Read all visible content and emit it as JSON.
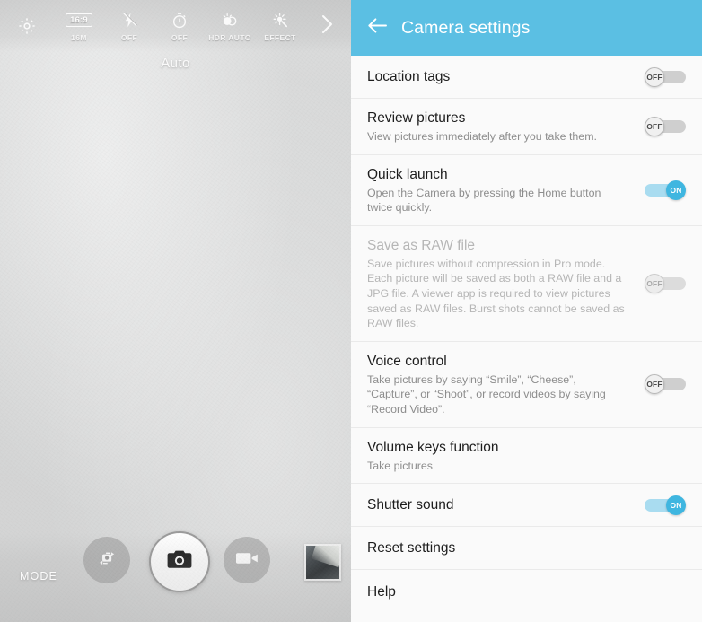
{
  "camera": {
    "mode_label": "Auto",
    "mode_button_label": "MODE",
    "toolbar": [
      {
        "icon": "settings-gear-icon",
        "label": "",
        "name": "camera-settings-gear"
      },
      {
        "icon": "aspect-ratio-icon",
        "ratio": "16:9",
        "label": "16M",
        "name": "camera-aspect-ratio"
      },
      {
        "icon": "flash-off-icon",
        "label": "OFF",
        "name": "camera-flash"
      },
      {
        "icon": "timer-icon",
        "label": "OFF",
        "name": "camera-timer"
      },
      {
        "icon": "hdr-icon",
        "label": "HDR AUTO",
        "name": "camera-hdr"
      },
      {
        "icon": "effect-icon",
        "label": "EFFECT",
        "name": "camera-effect"
      },
      {
        "icon": "chevron-right-icon",
        "label": "",
        "name": "camera-more"
      }
    ],
    "controls": [
      {
        "name": "switch-camera-button",
        "icon": "switch-camera-icon"
      },
      {
        "name": "shutter-button",
        "icon": "camera-icon"
      },
      {
        "name": "record-video-button",
        "icon": "video-camera-icon"
      },
      {
        "name": "gallery-thumbnail",
        "icon": "photo-thumbnail"
      }
    ]
  },
  "settings": {
    "title": "Camera settings",
    "back_icon": "back-arrow-icon",
    "accent_color": "#5bbfe3",
    "toggle_on_color": "#3fb6e0",
    "toggle_off_color": "#cfcfcf",
    "items": [
      {
        "name": "location-tags",
        "title": "Location tags",
        "subtitle": "",
        "control": "toggle",
        "state": "OFF",
        "enabled": true
      },
      {
        "name": "review-pictures",
        "title": "Review pictures",
        "subtitle": "View pictures immediately after you take them.",
        "control": "toggle",
        "state": "OFF",
        "enabled": true
      },
      {
        "name": "quick-launch",
        "title": "Quick launch",
        "subtitle": "Open the Camera by pressing the Home button twice quickly.",
        "control": "toggle",
        "state": "ON",
        "enabled": true
      },
      {
        "name": "save-as-raw-file",
        "title": "Save as RAW file",
        "subtitle": "Save pictures without compression in Pro mode. Each picture will be saved as both a RAW file and a JPG file. A viewer app is required to view pictures saved as RAW files. Burst shots cannot be saved as RAW files.",
        "control": "toggle",
        "state": "OFF",
        "enabled": false
      },
      {
        "name": "voice-control",
        "title": "Voice control",
        "subtitle": "Take pictures by saying “Smile”, “Cheese”, “Capture”, or “Shoot”, or record videos by saying “Record Video”.",
        "control": "toggle",
        "state": "OFF",
        "enabled": true
      },
      {
        "name": "volume-keys-function",
        "title": "Volume keys function",
        "subtitle": "Take pictures",
        "control": "none",
        "state": "",
        "enabled": true
      },
      {
        "name": "shutter-sound",
        "title": "Shutter sound",
        "subtitle": "",
        "control": "toggle",
        "state": "ON",
        "enabled": true
      },
      {
        "name": "reset-settings",
        "title": "Reset settings",
        "subtitle": "",
        "control": "none",
        "state": "",
        "enabled": true
      },
      {
        "name": "help",
        "title": "Help",
        "subtitle": "",
        "control": "none",
        "state": "",
        "enabled": true
      }
    ]
  }
}
